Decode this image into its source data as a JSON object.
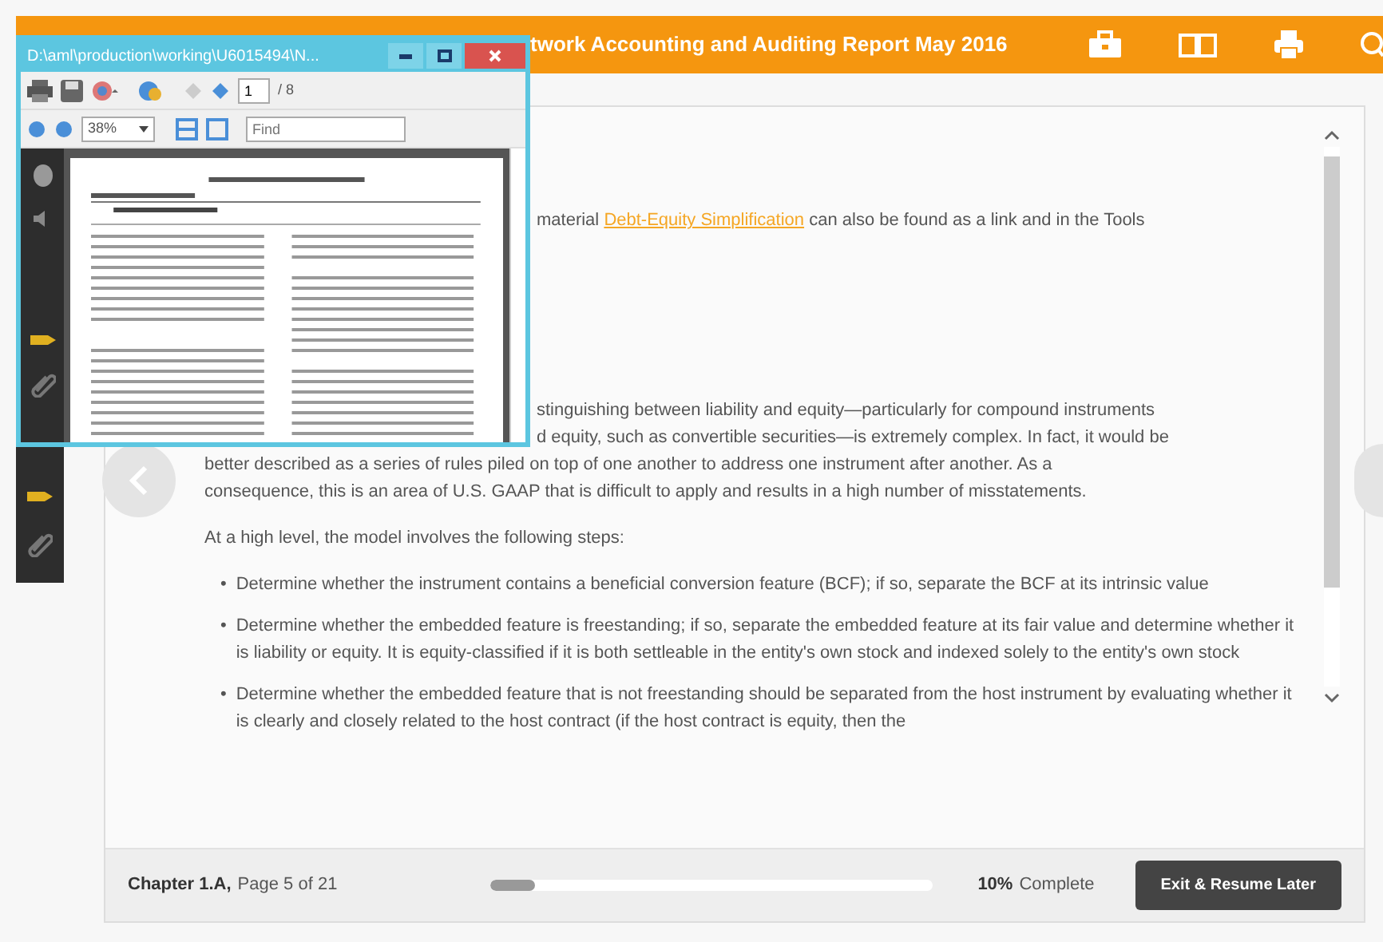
{
  "header": {
    "title": "twork Accounting and Auditing Report May 2016"
  },
  "pdf_window": {
    "title": "D:\\aml\\production\\working\\U6015494\\N...",
    "page_number": "1",
    "page_total": "/ 8",
    "zoom": "38%",
    "find_placeholder": "Find"
  },
  "content": {
    "intro": {
      "before": "material ",
      "link": "Debt-Equity Simplification",
      "after": " can also be found as a link and in the Tools"
    },
    "paragraph_lines": [
      {
        "kind": "partial",
        "text": "stinguishing between liability and equity—particularly for compound instruments"
      },
      {
        "kind": "partial",
        "text": "d equity, such as convertible securities—is extremely complex. In fact, it would be"
      },
      {
        "kind": "full",
        "text": "better described as a series of rules piled on top of one another to address one instrument after another. As a"
      },
      {
        "kind": "full",
        "text": "consequence, this is an area of U.S. GAAP that is difficult to apply and results in a high number of misstatements."
      }
    ],
    "lead": "At a high level, the model involves the following steps:",
    "steps": [
      {
        "marker": "•",
        "text": "Determine whether the instrument contains a beneficial conversion feature (BCF); if so, separate the BCF at its intrinsic value"
      },
      {
        "marker": "•",
        "text": "Determine whether the embedded feature is freestanding; if so, separate the embedded feature at its fair value and determine whether it is liability or equity. It is equity-classified if it is both settleable in the entity's own stock and indexed solely to the entity's own stock"
      },
      {
        "marker": "•",
        "text": "Determine whether the embedded feature that is not freestanding should be separated from the host instrument by evaluating whether it is clearly and closely related to the host contract (if the host contract is equity, then the"
      }
    ]
  },
  "footer": {
    "chapter": "Chapter 1.A,",
    "page": "Page 5 of 21",
    "progress": {
      "level": 0.1
    },
    "percent": "10%",
    "complete": "Complete",
    "button": "Exit & Resume Later"
  }
}
